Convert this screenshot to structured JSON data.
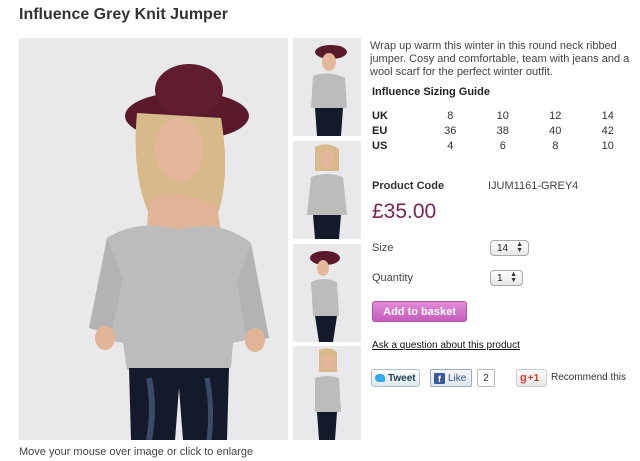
{
  "product": {
    "title": "Influence Grey Knit Jumper",
    "description": "Wrap up warm this winter in this round neck ribbed jumper.  Cosy and comfortable, team with jeans and a wool scarf for the perfect winter outfit.",
    "image_hint": "Move your mouse over image or click to enlarge",
    "product_code_label": "Product Code",
    "product_code": "IJUM1161-GREY4",
    "price": "£35.00",
    "colors": {
      "price": "#7a1f5a",
      "basket_button": "#d472cb",
      "image_bg": "#e9e9eb"
    }
  },
  "sizing": {
    "title": "Influence Sizing Guide",
    "rows": [
      {
        "label": "UK",
        "values": [
          "8",
          "10",
          "12",
          "14"
        ]
      },
      {
        "label": "EU",
        "values": [
          "36",
          "38",
          "40",
          "42"
        ]
      },
      {
        "label": "US",
        "values": [
          "4",
          "6",
          "8",
          "10"
        ]
      }
    ]
  },
  "options": {
    "size_label": "Size",
    "size_value": "14",
    "quantity_label": "Quantity",
    "quantity_value": "1"
  },
  "actions": {
    "basket_label": "Add to basket",
    "ask_link": "Ask a question about this product"
  },
  "social": {
    "tweet_label": "Tweet",
    "like_label": "Like",
    "like_count": "2",
    "gplus_label": "+1",
    "recommend_text": "Recommend this"
  }
}
